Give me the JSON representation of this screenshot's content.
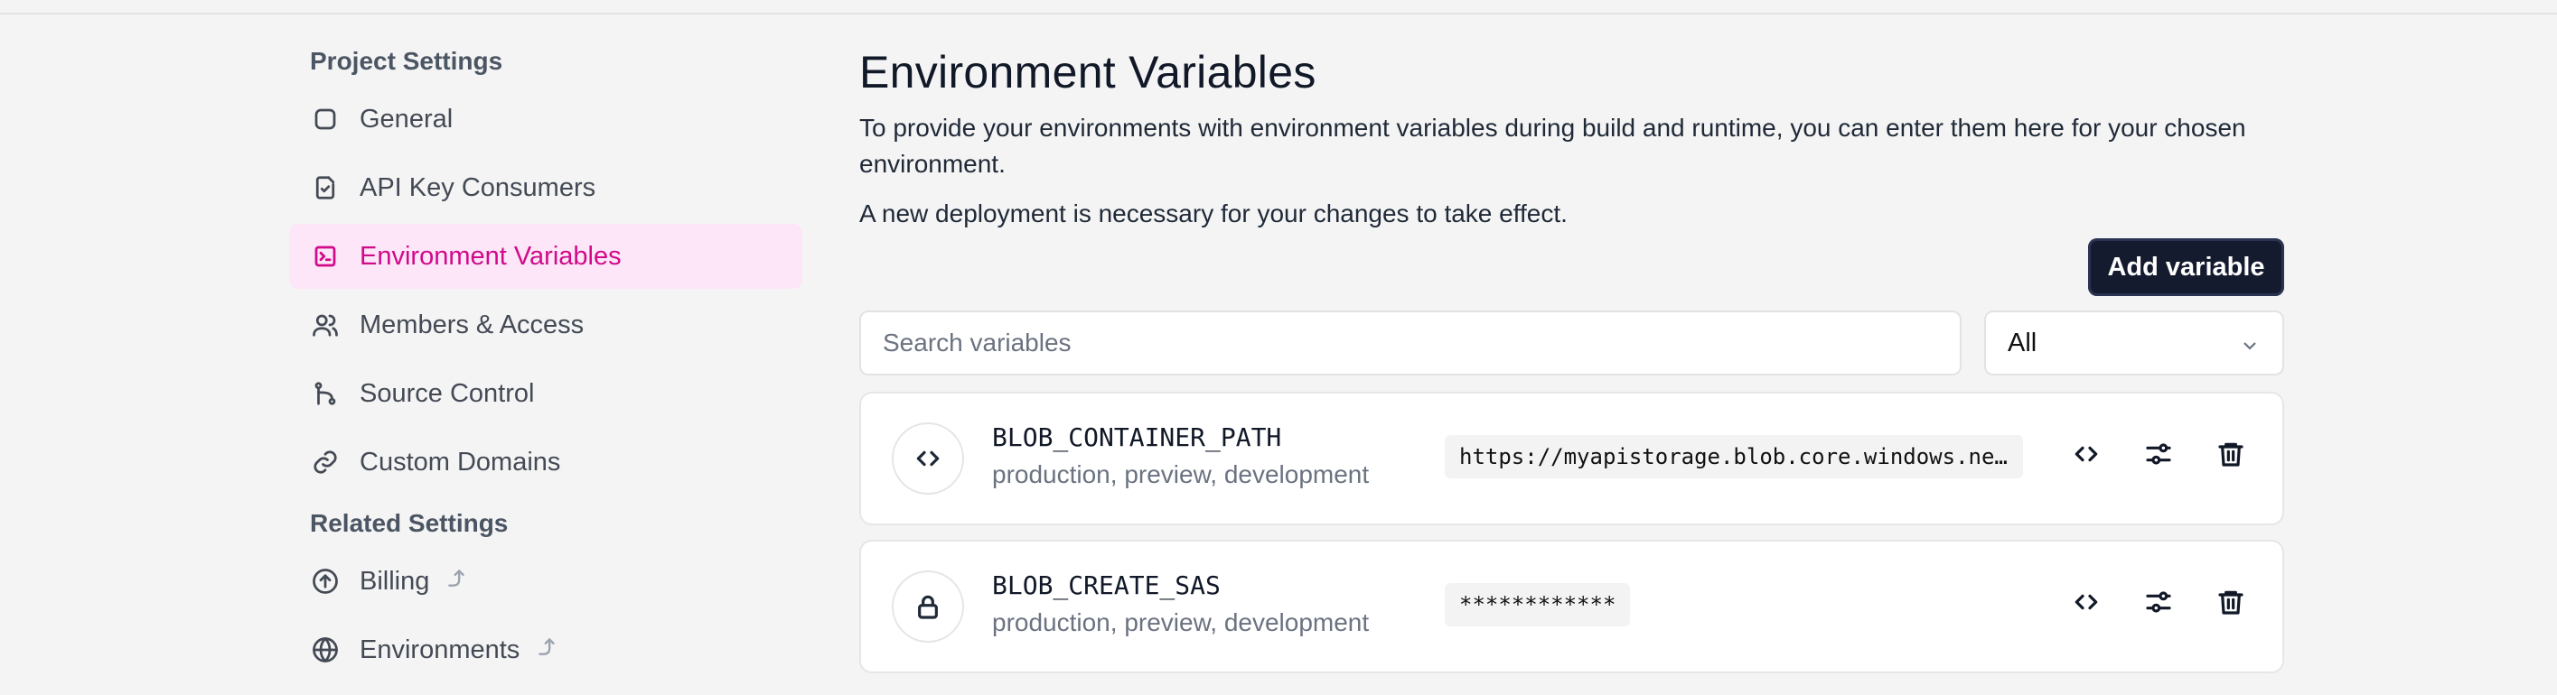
{
  "sidebar": {
    "project_title": "Project Settings",
    "project_items": [
      {
        "label": "General",
        "icon": "square-icon"
      },
      {
        "label": "API Key Consumers",
        "icon": "clipboard-check-icon"
      },
      {
        "label": "Environment Variables",
        "icon": "terminal-icon",
        "active": true
      },
      {
        "label": "Members & Access",
        "icon": "users-icon"
      },
      {
        "label": "Source Control",
        "icon": "git-branch-icon"
      },
      {
        "label": "Custom Domains",
        "icon": "link-icon"
      }
    ],
    "related_title": "Related Settings",
    "related_items": [
      {
        "label": "Billing",
        "icon": "arrow-up-circle-icon"
      },
      {
        "label": "Environments",
        "icon": "globe-icon"
      }
    ]
  },
  "main": {
    "title": "Environment Variables",
    "description": "To provide your environments with environment variables during build and runtime, you can enter them here for your chosen environment.",
    "note": "A new deployment is necessary for your changes to take effect.",
    "add_button": "Add variable",
    "search_placeholder": "Search variables",
    "filter_selected": "All"
  },
  "variables": [
    {
      "name": "BLOB_CONTAINER_PATH",
      "environments": "production, preview, development",
      "value": "https://myapistorage.blob.core.windows.net/container",
      "icon": "code-icon"
    },
    {
      "name": "BLOB_CREATE_SAS",
      "environments": "production, preview, development",
      "value": "************",
      "icon": "lock-icon"
    }
  ],
  "colors": {
    "accent": "#d10a8a",
    "accent_bg": "#fde6f7",
    "primary_button": "#141b2e",
    "background": "#f4f4f4"
  }
}
